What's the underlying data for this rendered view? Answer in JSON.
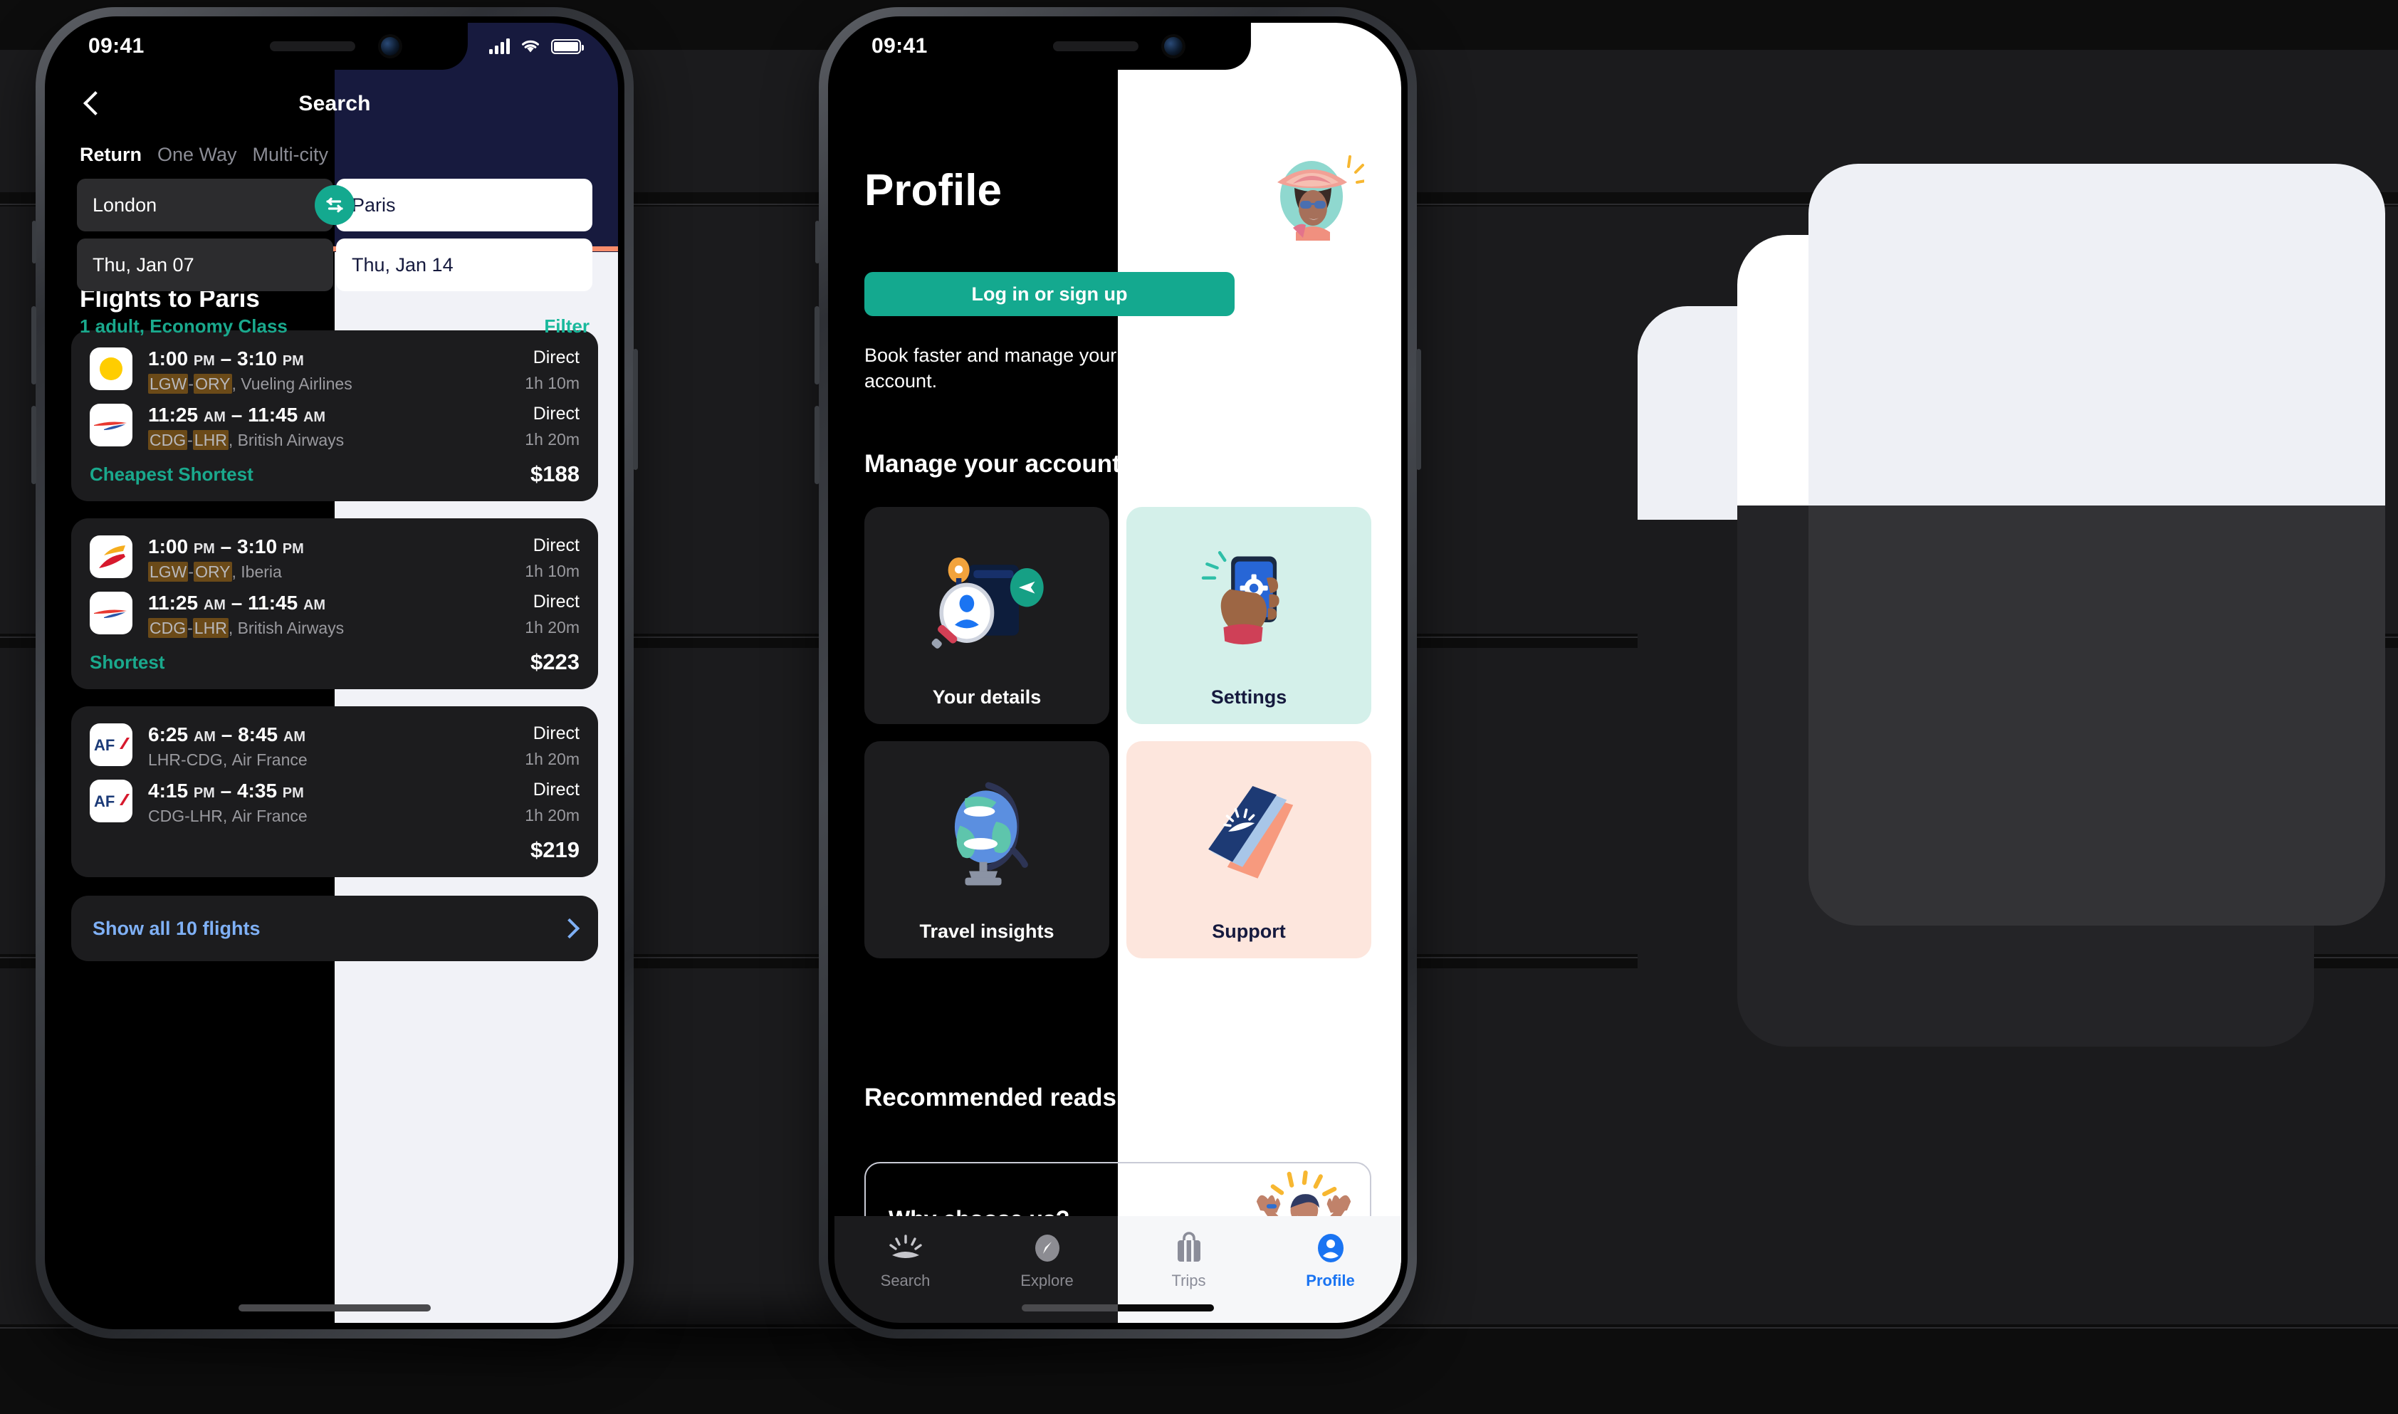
{
  "phone1": {
    "status": {
      "time": "09:41",
      "signal_icon": "cellular-bars-icon",
      "wifi_icon": "wifi-icon",
      "battery_icon": "battery-icon"
    },
    "nav": {
      "back_icon": "chevron-left-icon",
      "title": "Search"
    },
    "trip_tabs": [
      {
        "label": "Return",
        "active": true
      },
      {
        "label": "One Way",
        "active": false
      },
      {
        "label": "Multi-city",
        "active": false
      }
    ],
    "fields": {
      "origin": "London",
      "destination": "Paris",
      "depart_date": "Thu, Jan 07",
      "return_date": "Thu, Jan 14",
      "swap_icon": "swap-arrows-icon"
    },
    "pax": {
      "summary": "1 adult, Economy Class",
      "filter": "Filter"
    },
    "list_title": "Flights to Paris",
    "flights": [
      {
        "legs": [
          {
            "airline_logo": "vueling-logo",
            "depart": "1:00",
            "depart_ampm": "PM",
            "arrive": "3:10",
            "arrive_ampm": "PM",
            "route_from": "LGW",
            "route_to": "ORY",
            "airline": "Vueling Airlines",
            "stops": "Direct",
            "duration": "1h 10m",
            "highlight": true
          },
          {
            "airline_logo": "british-airways-logo",
            "depart": "11:25",
            "depart_ampm": "AM",
            "arrive": "11:45",
            "arrive_ampm": "AM",
            "route_from": "CDG",
            "route_to": "LHR",
            "airline": "British Airways",
            "stops": "Direct",
            "duration": "1h 20m",
            "highlight": true
          }
        ],
        "tag": "Cheapest Shortest",
        "price": "$188"
      },
      {
        "legs": [
          {
            "airline_logo": "iberia-logo",
            "depart": "1:00",
            "depart_ampm": "PM",
            "arrive": "3:10",
            "arrive_ampm": "PM",
            "route_from": "LGW",
            "route_to": "ORY",
            "airline": "Iberia",
            "stops": "Direct",
            "duration": "1h 10m",
            "highlight": true
          },
          {
            "airline_logo": "british-airways-logo",
            "depart": "11:25",
            "depart_ampm": "AM",
            "arrive": "11:45",
            "arrive_ampm": "AM",
            "route_from": "CDG",
            "route_to": "LHR",
            "airline": "British Airways",
            "stops": "Direct",
            "duration": "1h 20m",
            "highlight": true
          }
        ],
        "tag": "Shortest",
        "price": "$223"
      },
      {
        "legs": [
          {
            "airline_logo": "air-france-logo",
            "depart": "6:25",
            "depart_ampm": "AM",
            "arrive": "8:45",
            "arrive_ampm": "AM",
            "route_from": "LHR",
            "route_to": "CDG",
            "airline": "Air France",
            "stops": "Direct",
            "duration": "1h 20m",
            "highlight": false
          },
          {
            "airline_logo": "air-france-logo",
            "depart": "4:15",
            "depart_ampm": "PM",
            "arrive": "4:35",
            "arrive_ampm": "PM",
            "route_from": "CDG",
            "route_to": "LHR",
            "airline": "Air France",
            "stops": "Direct",
            "duration": "1h 20m",
            "highlight": false
          }
        ],
        "tag": "",
        "price": "$219"
      }
    ],
    "show_all": {
      "label": "Show all 10 flights",
      "chevron_icon": "chevron-right-icon"
    }
  },
  "phone2": {
    "status": {
      "time": "09:41",
      "signal_icon": "cellular-bars-icon",
      "wifi_icon": "wifi-icon",
      "battery_icon": "battery-icon"
    },
    "title": "Profile",
    "avatar_icon": "woman-in-sunhat-avatar",
    "login_button": "Log in or sign up",
    "blurb": "Book faster and manage your details more easily with an account.",
    "manage_heading": "Manage your account",
    "account_cards": [
      {
        "label": "Your details",
        "icon": "passport-magnifier-icon",
        "theme": "dark"
      },
      {
        "label": "Settings",
        "icon": "phone-gear-in-hand-icon",
        "theme": "mint"
      },
      {
        "label": "Travel insights",
        "icon": "globe-icon",
        "theme": "dark"
      },
      {
        "label": "Support",
        "icon": "blue-book-icon",
        "theme": "peach"
      }
    ],
    "reads_heading": "Recommended reads",
    "read_card": {
      "title": "Why choose us?",
      "icon": "cheering-person-icon"
    },
    "tabs": [
      {
        "label": "Search",
        "icon": "sunrise-icon",
        "active": false,
        "theme": "dark"
      },
      {
        "label": "Explore",
        "icon": "compass-icon",
        "active": false,
        "theme": "dark"
      },
      {
        "label": "Trips",
        "icon": "suitcase-icon",
        "active": false,
        "theme": "light"
      },
      {
        "label": "Profile",
        "icon": "person-circle-icon",
        "active": true,
        "theme": "light"
      }
    ]
  },
  "colors": {
    "teal": "#14a98f",
    "navy": "#171a3e",
    "orange_rule": "#f98c6b",
    "link_blue": "#7fb0f5",
    "active_blue": "#1a74f2",
    "code_highlight": "#6b4a18",
    "card_dark": "#1c1c1e",
    "mint": "#d4f0ea",
    "peach": "#fde6dd",
    "light_bg": "#f1f2f7"
  }
}
